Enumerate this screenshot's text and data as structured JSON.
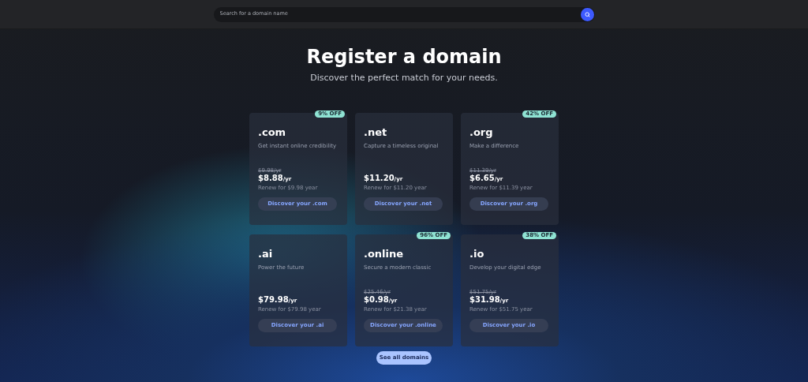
{
  "search": {
    "placeholder": "Search for a domain name"
  },
  "title": "Register a domain",
  "subtitle": "Discover the perfect match for your needs.",
  "cards": [
    {
      "tld": ".com",
      "tagline": "Get instant online credibility",
      "badge": "9% OFF",
      "old_price": "$9.98/yr",
      "price": "$8.88",
      "unit": "/yr",
      "renew": "Renew for $9.98 year",
      "button": "Discover your .com"
    },
    {
      "tld": ".net",
      "tagline": "Capture a timeless original",
      "price": "$11.20",
      "unit": "/yr",
      "renew": "Renew for $11.20 year",
      "button": "Discover your .net"
    },
    {
      "tld": ".org",
      "tagline": "Make a difference",
      "badge": "42% OFF",
      "old_price": "$11.39/yr",
      "price": "$6.65",
      "unit": "/yr",
      "renew": "Renew for $11.39 year",
      "button": "Discover your .org"
    },
    {
      "tld": ".ai",
      "tagline": "Power the future",
      "price": "$79.98",
      "unit": "/yr",
      "renew": "Renew for $79.98 year",
      "button": "Discover your .ai"
    },
    {
      "tld": ".online",
      "tagline": "Secure a modern classic",
      "badge": "96% OFF",
      "old_price": "$25.46/yr",
      "price": "$0.98",
      "unit": "/yr",
      "renew": "Renew for $21.38 year",
      "button": "Discover your .online"
    },
    {
      "tld": ".io",
      "tagline": "Develop your digital edge",
      "badge": "38% OFF",
      "old_price": "$51.75/yr",
      "price": "$31.98",
      "unit": "/yr",
      "renew": "Renew for $51.75 year",
      "button": "Discover your .io"
    }
  ],
  "see_all": "See all domains"
}
